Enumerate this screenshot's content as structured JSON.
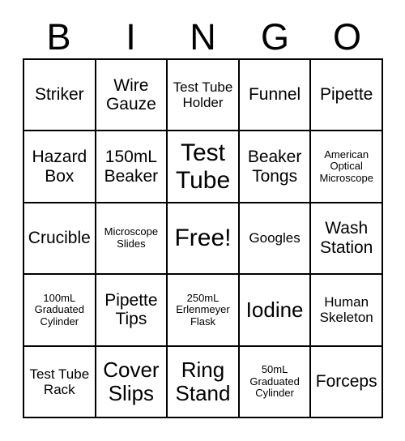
{
  "header": {
    "letters": [
      "B",
      "I",
      "N",
      "G",
      "O"
    ]
  },
  "grid": {
    "rows": 5,
    "columns": 5,
    "border_color": "#000000",
    "background_color": "#ffffff",
    "text_color": "#000000",
    "cells": [
      {
        "text": "Striker",
        "size": "fs-md"
      },
      {
        "text": "Wire Gauze",
        "size": "fs-md"
      },
      {
        "text": "Test Tube Holder",
        "size": "fs-sm"
      },
      {
        "text": "Funnel",
        "size": "fs-md"
      },
      {
        "text": "Pipette",
        "size": "fs-md"
      },
      {
        "text": "Hazard Box",
        "size": "fs-md"
      },
      {
        "text": "150mL Beaker",
        "size": "fs-md"
      },
      {
        "text": "Test Tube",
        "size": "fs-xl"
      },
      {
        "text": "Beaker Tongs",
        "size": "fs-md"
      },
      {
        "text": "American Optical Microscope",
        "size": "fs-xs"
      },
      {
        "text": "Crucible",
        "size": "fs-md"
      },
      {
        "text": "Microscope Slides",
        "size": "fs-xs"
      },
      {
        "text": "Free!",
        "size": "fs-xl"
      },
      {
        "text": "Googles",
        "size": "fs-sm"
      },
      {
        "text": "Wash Station",
        "size": "fs-md"
      },
      {
        "text": "100mL Graduated Cylinder",
        "size": "fs-xs"
      },
      {
        "text": "Pipette Tips",
        "size": "fs-md"
      },
      {
        "text": "250mL Erlenmeyer Flask",
        "size": "fs-xs"
      },
      {
        "text": "Iodine",
        "size": "fs-lg"
      },
      {
        "text": "Human Skeleton",
        "size": "fs-sm"
      },
      {
        "text": "Test Tube Rack",
        "size": "fs-sm"
      },
      {
        "text": "Cover Slips",
        "size": "fs-lg"
      },
      {
        "text": "Ring Stand",
        "size": "fs-lg"
      },
      {
        "text": "50mL Graduated Cylinder",
        "size": "fs-xs"
      },
      {
        "text": "Forceps",
        "size": "fs-md"
      }
    ]
  }
}
